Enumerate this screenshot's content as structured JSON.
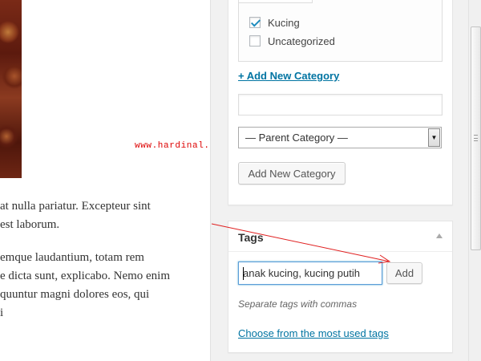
{
  "editor": {
    "paragraph1": [
      "at nulla pariatur. Excepteur sint",
      "est laborum."
    ],
    "paragraph2": [
      "emque laudantium, totam rem",
      "e dicta sunt, explicabo. Nemo enim",
      "quuntur magni dolores eos, qui",
      "i"
    ],
    "watermark": "www.hardinal.com"
  },
  "categories": {
    "items": [
      {
        "label": "Kucing",
        "checked": true
      },
      {
        "label": "Uncategorized",
        "checked": false
      }
    ],
    "add_new_link": "+ Add New Category",
    "new_category_value": "",
    "parent_select_value": "— Parent Category —",
    "add_new_button": "Add New Category"
  },
  "tags": {
    "title": "Tags",
    "input_value": "anak kucing, kucing putih",
    "add_button": "Add",
    "hint": "Separate tags with commas",
    "choose_link": "Choose from the most used tags"
  },
  "colors": {
    "link": "#0074a2",
    "annotation": "#e02020",
    "focus": "#5b9dd9"
  }
}
